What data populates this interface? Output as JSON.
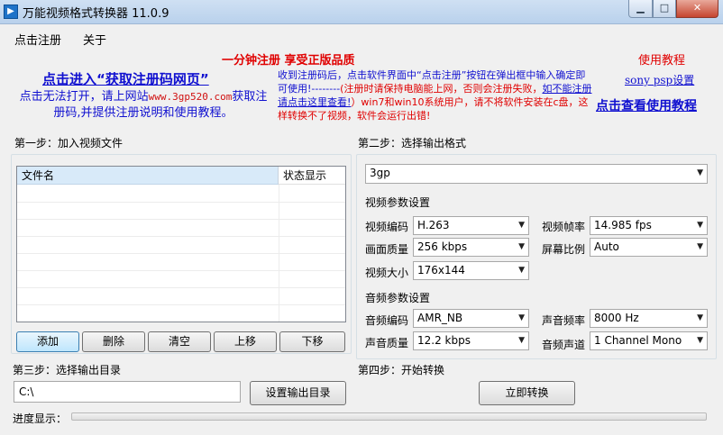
{
  "window": {
    "title": "万能视频格式转换器 11.0.9",
    "icon": "app-icon"
  },
  "menu": {
    "items": [
      "点击注册",
      "关于"
    ]
  },
  "banner": {
    "promo": "一分钟注册  享受正版品质",
    "help_title": "使用教程",
    "reg_link": "点击进入“获取注册码网页”",
    "fallback_pre": "点击无法打开，请上网站",
    "site": "www.3gp520.com",
    "fallback_post": "获取注册码,并提供注册说明和使用教程。",
    "notice_1": "收到注册码后，点击软件界面中“点击注册”按钮在弹出框中输入确定即可使用!--------",
    "notice_2": "(注册时请保持电脑能上网，否则会注册失败，",
    "notice_link": "如不能注册请点击这里查看!",
    "notice_3": "）win7和win10系统用户，请不将软件安装在c盘，这样转换不了视频，软件会运行出错!",
    "sony_link": "sony psp设置",
    "help_link": "点击查看使用教程"
  },
  "step1": {
    "label": "第一步：加入视频文件",
    "columns": [
      "文件名",
      "状态显示"
    ],
    "buttons": [
      "添加",
      "删除",
      "清空",
      "上移",
      "下移"
    ]
  },
  "step2": {
    "label": "第二步：选择输出格式",
    "format": "3gp",
    "video_section": "视频参数设置",
    "video_codec_label": "视频编码",
    "video_codec": "H.263",
    "frame_rate_label": "视频帧率",
    "frame_rate": "14.985 fps",
    "quality_label": "画面质量",
    "quality": "256 kbps",
    "aspect_label": "屏幕比例",
    "aspect": "Auto",
    "size_label": "视频大小",
    "size": "176x144",
    "audio_section": "音频参数设置",
    "audio_codec_label": "音频编码",
    "audio_codec": "AMR_NB",
    "sample_rate_label": "声音频率",
    "sample_rate": "8000 Hz",
    "audio_quality_label": "声音质量",
    "audio_quality": "12.2 kbps",
    "channel_label": "音频声道",
    "channel": "1 Channel Mono"
  },
  "step3": {
    "label": "第三步：选择输出目录",
    "output_dir": "C:\\",
    "set_dir_button": "设置输出目录"
  },
  "step4": {
    "label": "第四步：开始转换",
    "convert_button": "立即转换"
  },
  "progress": {
    "label": "进度显示：",
    "value": 0
  }
}
